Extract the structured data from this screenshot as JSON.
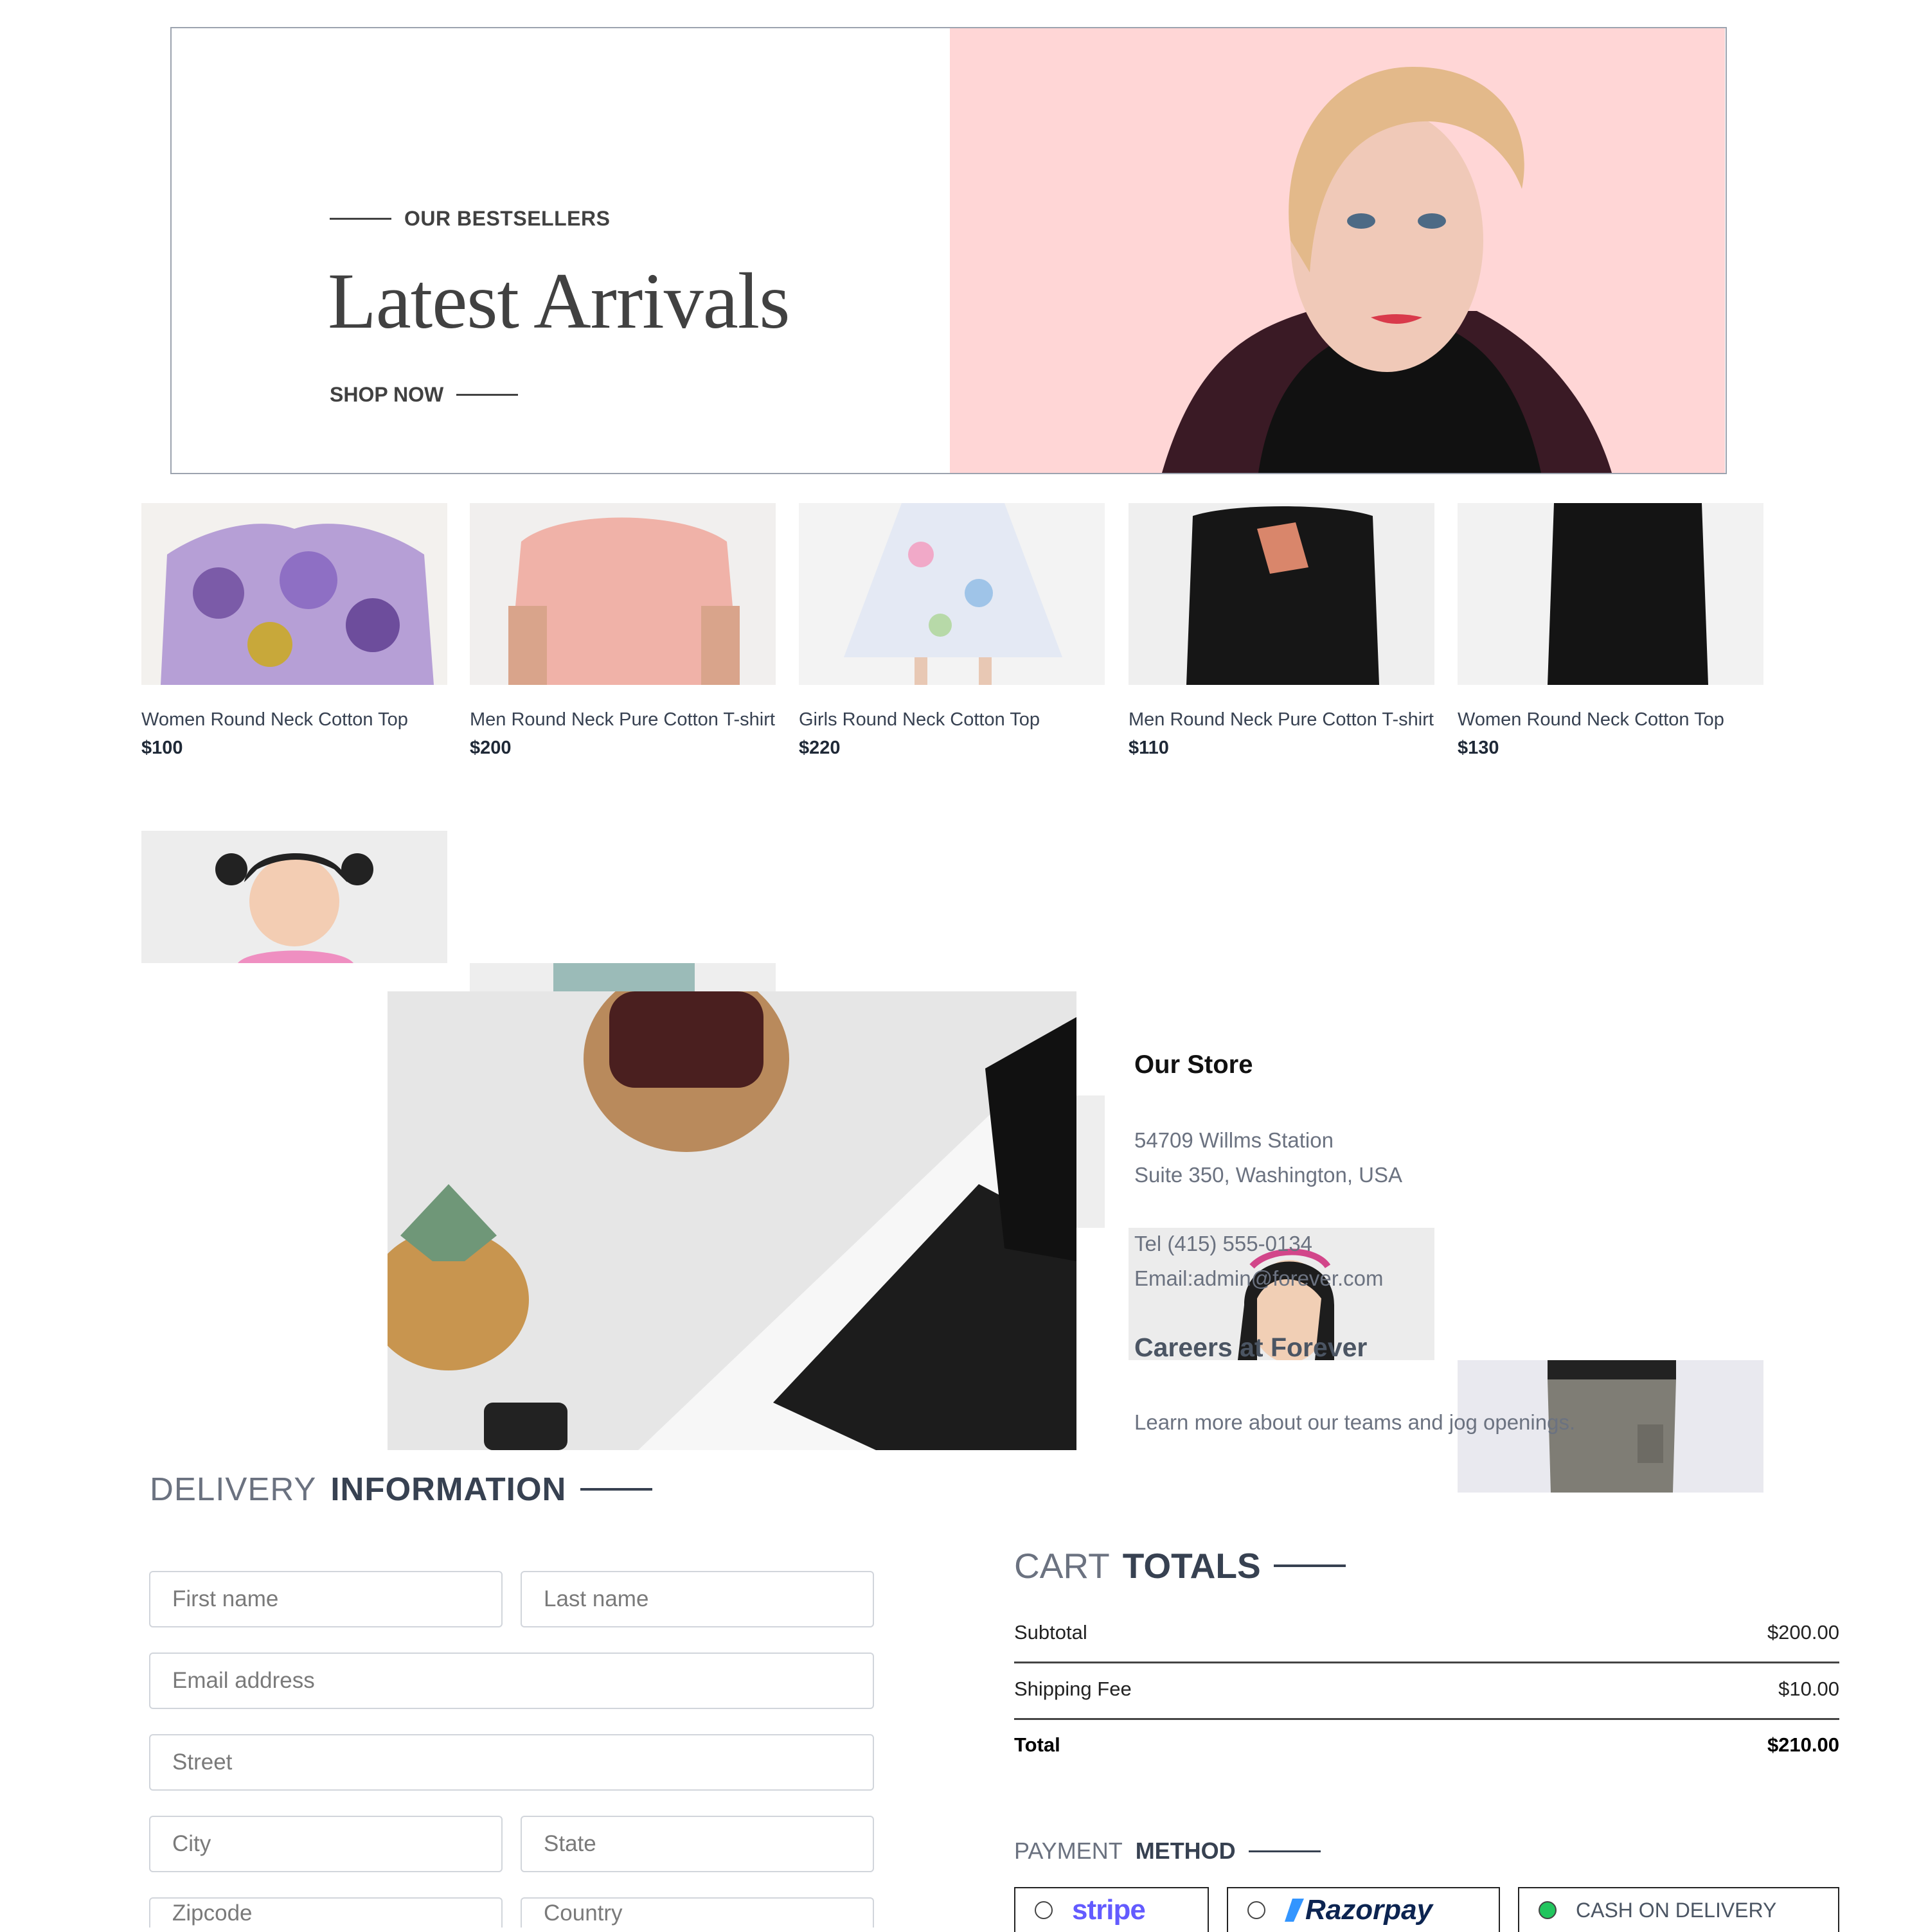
{
  "hero": {
    "eyebrow": "OUR BESTSELLERS",
    "title": "Latest Arrivals",
    "cta": "SHOP NOW"
  },
  "products": [
    {
      "name": "Women Round Neck Cotton Top",
      "price": "$100"
    },
    {
      "name": "Men Round Neck Pure Cotton T-shirt",
      "price": "$200"
    },
    {
      "name": "Girls Round Neck Cotton Top",
      "price": "$220"
    },
    {
      "name": "Men Round Neck Pure Cotton T-shirt",
      "price": "$110"
    },
    {
      "name": "Women Round Neck Cotton Top",
      "price": "$130"
    }
  ],
  "store": {
    "title": "Our Store",
    "address1": "54709 Willms Station",
    "address2": "Suite 350, Washington, USA",
    "tel": "Tel (415) 555-0134",
    "email": "Email:admin@forever.com",
    "careers_title": "Careers at Forever",
    "careers_text": "Learn more about our teams and jog openings."
  },
  "delivery": {
    "title_a": "DELIVERY",
    "title_b": "INFORMATION",
    "placeholders": {
      "first": "First name",
      "last": "Last name",
      "email": "Email address",
      "street": "Street",
      "city": "City",
      "state": "State",
      "zip": "Zipcode",
      "country": "Country"
    }
  },
  "cart": {
    "title_a": "CART",
    "title_b": "TOTALS",
    "subtotal_label": "Subtotal",
    "subtotal": "$200.00",
    "shipping_label": "Shipping Fee",
    "shipping": "$10.00",
    "total_label": "Total",
    "total": "$210.00"
  },
  "payment": {
    "title_a": "PAYMENT",
    "title_b": "METHOD",
    "stripe": "stripe",
    "razorpay": "Razorpay",
    "cod": "CASH ON DELIVERY",
    "selected": "cod"
  },
  "colors": {
    "hero_bg": "#ffd6d6",
    "brand_stripe": "#635bff",
    "brand_razorpay": "#0c2451",
    "selected_radio": "#22c55e"
  }
}
